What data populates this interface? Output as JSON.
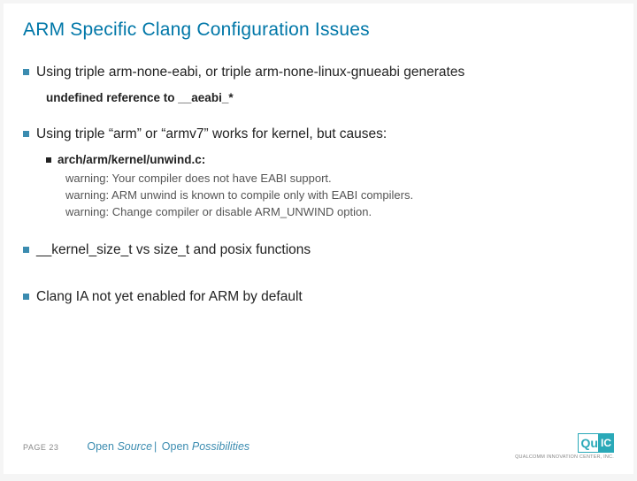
{
  "title": "ARM Specific Clang Configuration Issues",
  "bullets": [
    {
      "text": "Using triple arm-none-eabi, or triple arm-none-linux-gnueabi generates",
      "sub_plain": "undefined reference to __aeabi_*"
    },
    {
      "text": "Using triple “arm” or “armv7” works for kernel, but causes:",
      "sub_bullet": "arch/arm/kernel/unwind.c:",
      "sub_lines": [
        "warning: Your compiler does not have EABI support.",
        "warning: ARM unwind is known to compile only with EABI compilers.",
        "warning: Change compiler or disable ARM_UNWIND option."
      ]
    },
    {
      "text": "__kernel_size_t  vs size_t and posix functions"
    },
    {
      "text": "Clang IA not yet enabled for ARM by default"
    }
  ],
  "footer": {
    "page": "PAGE 23",
    "tagline_1": "Open",
    "tagline_2": "Source",
    "tagline_3": "Open",
    "tagline_4": "Possibilities",
    "logo_u": "Qu",
    "logo_ic": "IC",
    "logo_sub": "QUALCOMM INNOVATION CENTER, INC."
  }
}
